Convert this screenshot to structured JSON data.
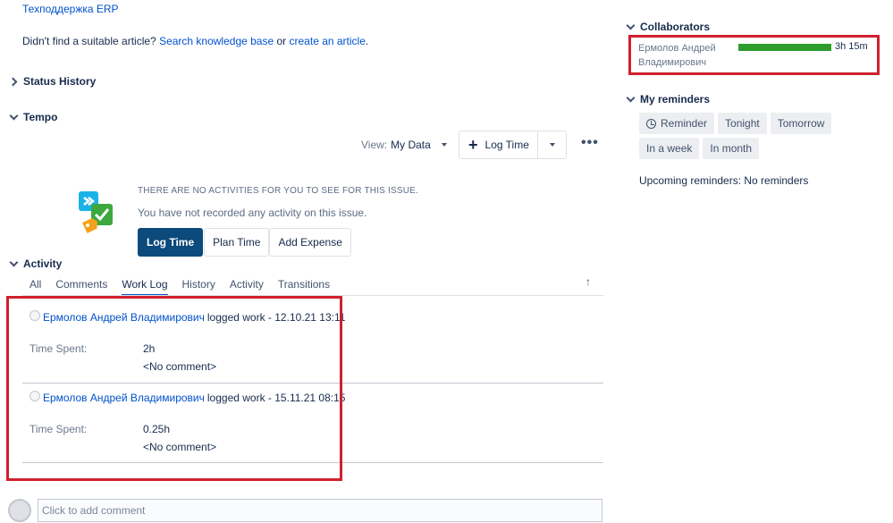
{
  "top_link": "Техподдержка ERP",
  "kb": {
    "prefix": "Didn't find a suitable article?",
    "search_link": "Search knowledge base",
    "or": "or",
    "create_link": "create an article",
    "suffix": "."
  },
  "sections": {
    "status_history": "Status History",
    "tempo": "Tempo",
    "activity": "Activity"
  },
  "tempo": {
    "view_label": "View:",
    "view_value": "My Data",
    "log_time_label": "Log Time",
    "empty_title": "THERE ARE NO ACTIVITIES FOR YOU TO SEE FOR THIS ISSUE.",
    "empty_desc": "You have not recorded any activity on this issue.",
    "buttons": [
      "Log Time",
      "Plan Time",
      "Add Expense"
    ]
  },
  "activity_tabs": [
    "All",
    "Comments",
    "Work Log",
    "History",
    "Activity",
    "Transitions"
  ],
  "active_tab": "Work Log",
  "worklogs": [
    {
      "author": "Ермолов Андрей Владимирович",
      "action": "logged work - 12.10.21 13:11",
      "time_spent_label": "Time Spent:",
      "time_spent": "2h",
      "comment": "<No comment>"
    },
    {
      "author": "Ермолов Андрей Владимирович",
      "action": "logged work - 15.11.21 08:15",
      "time_spent_label": "Time Spent:",
      "time_spent": "0.25h",
      "comment": "<No comment>"
    }
  ],
  "comment_placeholder": "Click to add comment",
  "collaborators": {
    "title": "Collaborators",
    "name_line1": "Ермолов Андрей",
    "name_line2": "Владимирович",
    "time": "3h 15m",
    "bar_color": "#2d9e2d"
  },
  "reminders": {
    "title": "My reminders",
    "buttons": [
      "Reminder",
      "Tonight",
      "Tomorrow",
      "In a week",
      "In month"
    ],
    "upcoming": "Upcoming reminders: No reminders"
  },
  "colors": {
    "link": "#0052cc",
    "primary_button": "#0b4a7a",
    "highlight": "#d0202d"
  },
  "icons": {
    "tempo_logo": "tempo-logo-icon",
    "more": "more-icon",
    "plus": "plus-icon",
    "clock": "clock-icon",
    "scroll_top": "arrow-up-icon"
  }
}
